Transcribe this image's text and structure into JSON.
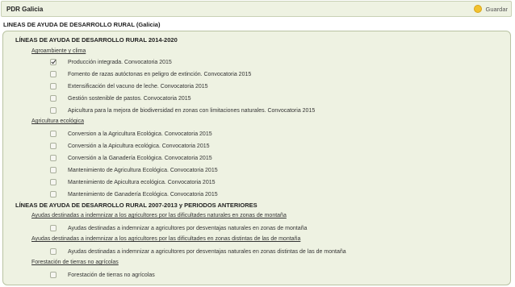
{
  "header": {
    "title": "PDR Galicia",
    "save_label": "Guardar"
  },
  "page_heading": "LINEAS DE AYUDA DE DESARROLLO RURAL (Galicia)",
  "sections": [
    {
      "title": "LÍNEAS DE AYUDA DE DESARROLLO RURAL 2014-2020",
      "groups": [
        {
          "name": "Agroambiente y clima",
          "items": [
            {
              "label": "Producción integrada. Convocatoria 2015",
              "checked": true
            },
            {
              "label": "Fomento de razas autóctonas en peligro de extinción. Convocatoria 2015",
              "checked": false
            },
            {
              "label": "Extensificación del vacuno de leche. Convocatoria 2015",
              "checked": false
            },
            {
              "label": "Gestión sostenible de pastos. Convocatoria 2015",
              "checked": false
            },
            {
              "label": "Apicultura para la mejora de biodiversidad en zonas con limitaciones naturales. Convocatoria 2015",
              "checked": false
            }
          ]
        },
        {
          "name": "Agricultura ecológica",
          "items": [
            {
              "label": "Conversion a la Agricultura Ecológica. Convocatoria 2015",
              "checked": false
            },
            {
              "label": "Conversión a la Apicultura ecológica. Convocatoria 2015",
              "checked": false
            },
            {
              "label": "Conversión a la Ganadería Ecológica. Convocatoria 2015",
              "checked": false
            },
            {
              "label": "Mantenimiento de Agricultura Ecológica. Convocatoria 2015",
              "checked": false
            },
            {
              "label": "Mantenimiento de Apicultura ecológica. Convocatoria 2015",
              "checked": false
            },
            {
              "label": "Mantenimiento de Ganadería Ecológica. Convocatoria 2015",
              "checked": false
            }
          ]
        }
      ]
    },
    {
      "title": "LÍNEAS DE AYUDA DE DESARROLLO RURAL 2007-2013 y PERIODOS ANTERIORES",
      "groups": [
        {
          "name": "Ayudas destinadas a indemnizar a los agricultores por las dificultades naturales en zonas de montaña",
          "items": [
            {
              "label": "Ayudas destinadas a indemnizar a agricultores por desventajas naturales en zonas de montaña",
              "checked": false
            }
          ]
        },
        {
          "name": "Ayudas destinadas a indemnizar a los agricultores por las dificultades en zonas distintas de las de montaña",
          "items": [
            {
              "label": "Ayudas destinadas a indemnizar a agricultores por desventajas naturales en zonas distintas de las de montaña",
              "checked": false
            }
          ]
        },
        {
          "name": "Forestación de tierras no agrícolas",
          "items": [
            {
              "label": "Forestación de tierras no agrícolas",
              "checked": false
            }
          ]
        }
      ]
    }
  ]
}
